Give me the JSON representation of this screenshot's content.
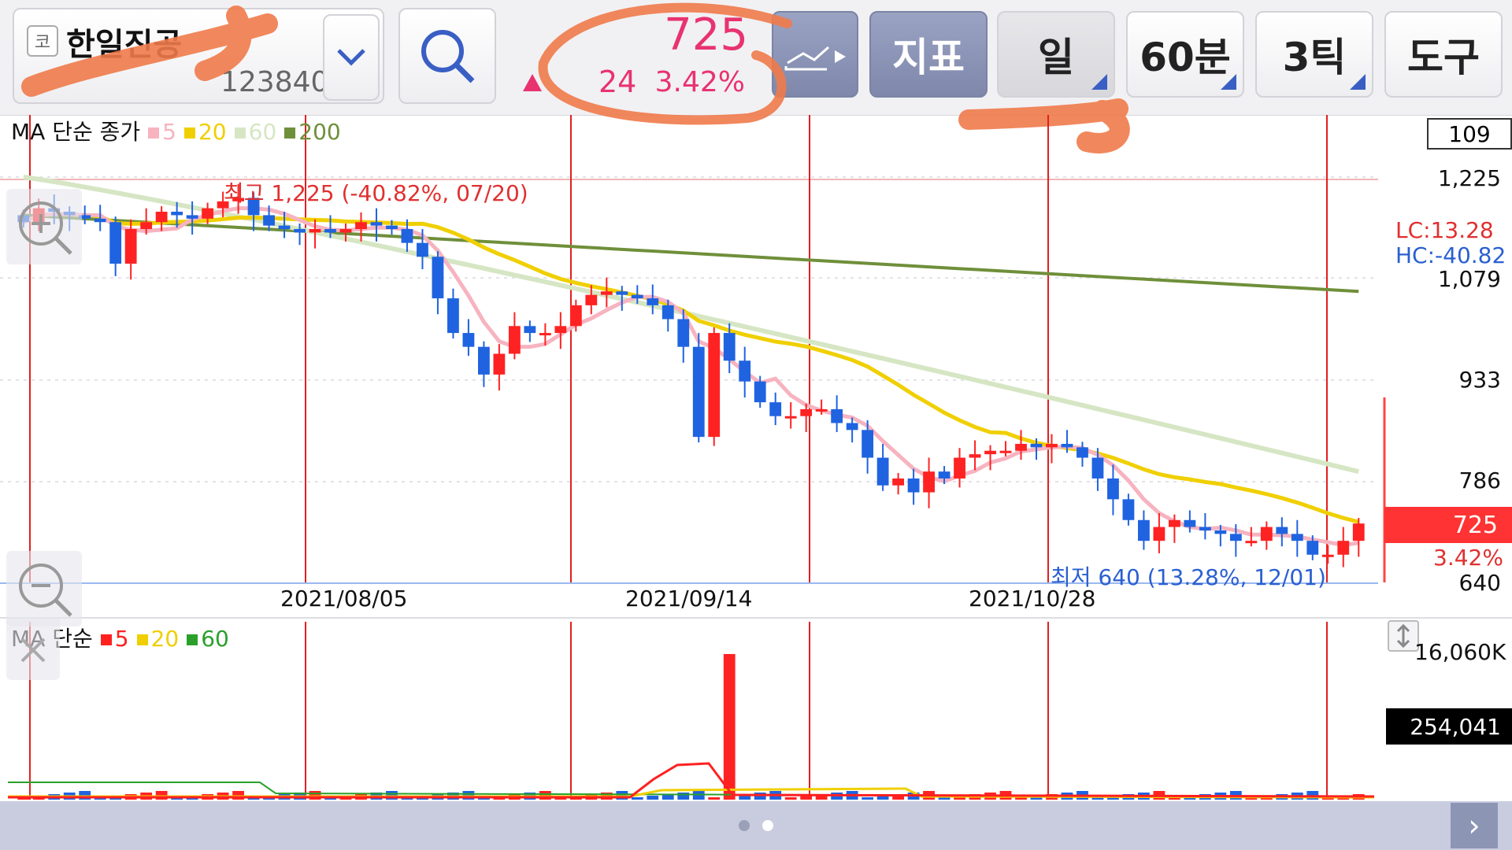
{
  "header": {
    "exchange_badge": "코",
    "stock_name": "한일진공",
    "stock_code": "123840",
    "price": "725",
    "change": "24",
    "change_pct": "3.42%",
    "indicator_label": "지표",
    "period_day": "일",
    "period_60min": "60분",
    "period_3tick": "3틱",
    "tools_label": "도구"
  },
  "price_chart": {
    "legend_title": "MA 단순 종가",
    "legend": [
      {
        "label": "5",
        "color": "#f7b3c0"
      },
      {
        "label": "20",
        "color": "#f0cf00"
      },
      {
        "label": "60",
        "color": "#d6e6c4"
      },
      {
        "label": "200",
        "color": "#6f8f3a"
      }
    ],
    "scale_box": "109",
    "high_label": "최고 1,225 (-40.82%, 07/20)",
    "low_label": "최저 640 (13.28%, 12/01)",
    "lc": "LC:13.28",
    "hc": "HC:-40.82",
    "y_ticks": [
      "1,225",
      "1,079",
      "933",
      "786",
      "640"
    ],
    "current_price": "725",
    "current_pct": "3.42%",
    "dates": [
      "2021/08/05",
      "2021/09/14",
      "2021/10/28"
    ]
  },
  "volume_chart": {
    "legend_title": "MA 단순",
    "legend": [
      {
        "label": "5",
        "color": "#ff2020"
      },
      {
        "label": "20",
        "color": "#f0cf00"
      },
      {
        "label": "60",
        "color": "#2aa02a"
      }
    ],
    "max_label": "16,060K",
    "current_volume": "254,041"
  },
  "chart_data": {
    "type": "candlestick",
    "y_range": [
      640,
      1225
    ],
    "ma200_start": 1170,
    "ma200_end": 1060,
    "ma60_start": 1225,
    "ma60_end": 800,
    "closes": [
      1160,
      1180,
      1175,
      1170,
      1165,
      1160,
      1100,
      1150,
      1160,
      1175,
      1170,
      1165,
      1180,
      1190,
      1195,
      1170,
      1155,
      1150,
      1145,
      1150,
      1145,
      1150,
      1160,
      1155,
      1150,
      1130,
      1110,
      1050,
      1000,
      980,
      940,
      970,
      1010,
      1000,
      1000,
      1010,
      1040,
      1055,
      1060,
      1055,
      1050,
      1040,
      1020,
      980,
      850,
      1000,
      960,
      930,
      900,
      880,
      880,
      890,
      890,
      870,
      860,
      820,
      780,
      790,
      770,
      800,
      790,
      820,
      825,
      830,
      830,
      840,
      835,
      840,
      835,
      820,
      790,
      760,
      730,
      700,
      720,
      730,
      720,
      715,
      710,
      700,
      700,
      720,
      710,
      700,
      680,
      680,
      700,
      725
    ],
    "volume_spike_index": 46
  }
}
